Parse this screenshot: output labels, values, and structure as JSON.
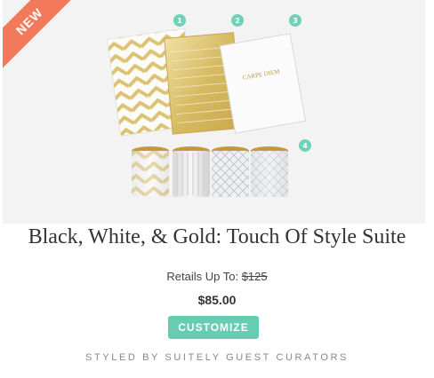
{
  "product": {
    "ribbon": "NEW",
    "badges": [
      "1",
      "2",
      "3",
      "4"
    ],
    "notebook_cover_text": "CARPE DIEM",
    "title": "Black, White, & Gold: Touch Of Style Suite",
    "retail_prefix": "Retails Up To: ",
    "retail_price": "$125",
    "price": "$85.00",
    "customize_label": "CUSTOMIZE",
    "styled_by": "STYLED BY SUITELY GUEST CURATORS"
  },
  "colors": {
    "ribbon": "#f27a5a",
    "accent": "#66ccb2",
    "badge": "#6fd1b9",
    "gold": "#d8bf6a"
  }
}
